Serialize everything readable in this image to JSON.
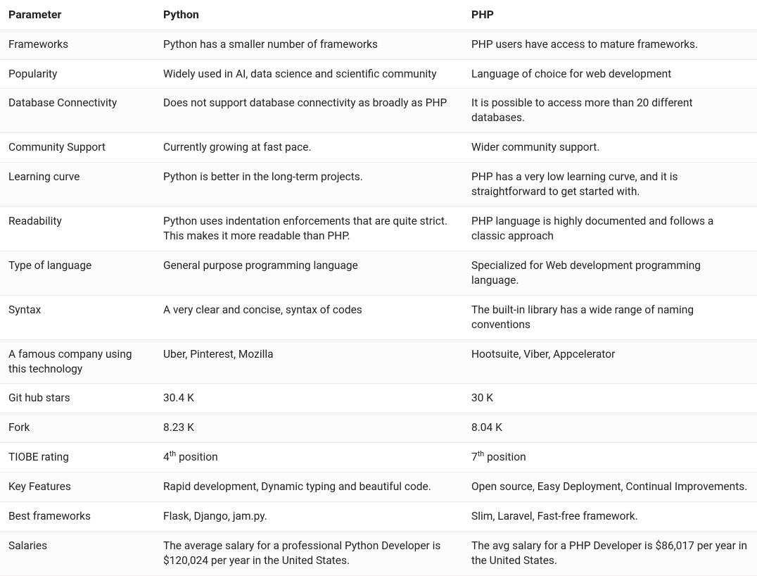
{
  "headers": {
    "parameter": "Parameter",
    "python": "Python",
    "php": "PHP"
  },
  "rows": [
    {
      "parameter": "Frameworks",
      "python": "Python has a smaller number of frameworks",
      "php": "PHP users have access to mature frameworks."
    },
    {
      "parameter": "Popularity",
      "python": "Widely used in AI, data science and scientific community",
      "php": "Language of choice for web development"
    },
    {
      "parameter": "Database Connectivity",
      "python": "Does not support database connectivity as broadly as PHP",
      "php": "It is possible to access more than 20 different databases."
    },
    {
      "parameter": "Community Support",
      "python": "Currently growing at fast pace.",
      "php": "Wider community support."
    },
    {
      "parameter": "Learning curve",
      "python": "Python is better in the long-term projects.",
      "php": "PHP has a very low learning curve, and it is straightforward to get started with."
    },
    {
      "parameter": "Readability",
      "python": "Python uses indentation enforcements that are quite strict. This makes it more readable than PHP.",
      "php": "PHP language is highly documented and follows a classic approach"
    },
    {
      "parameter": "Type of language",
      "python": "General purpose programming language",
      "php": "Specialized for Web development programming language."
    },
    {
      "parameter": "Syntax",
      "python": "A very clear and concise, syntax of codes",
      "php": "The built-in library has a wide range of naming conventions"
    },
    {
      "parameter": "A famous company using this technology",
      "python": "Uber, Pinterest, Mozilla",
      "php": "Hootsuite, Viber, Appcelerator"
    },
    {
      "parameter": "Git hub stars",
      "python": "30.4 K",
      "php": "30 K"
    },
    {
      "parameter": "Fork",
      "python": "8.23 K",
      "php": "8.04 K"
    },
    {
      "parameter": "TIOBE rating",
      "python_html": "4<sup>th</sup> position",
      "php_html": "7<sup>th</sup> position"
    },
    {
      "parameter": "Key Features",
      "python": "Rapid development, Dynamic typing and beautiful code.",
      "php": "Open source, Easy Deployment, Continual Improvements."
    },
    {
      "parameter": "Best frameworks",
      "python": "Flask, Django, jam.py.",
      "php": "Slim, Laravel, Fast-free framework."
    },
    {
      "parameter": "Salaries",
      "python": "The average salary for a professional Python Developer is $120,024 per year in the United States.",
      "php": "The avg salary for a PHP Developer is $86,017 per year in the United States."
    }
  ]
}
